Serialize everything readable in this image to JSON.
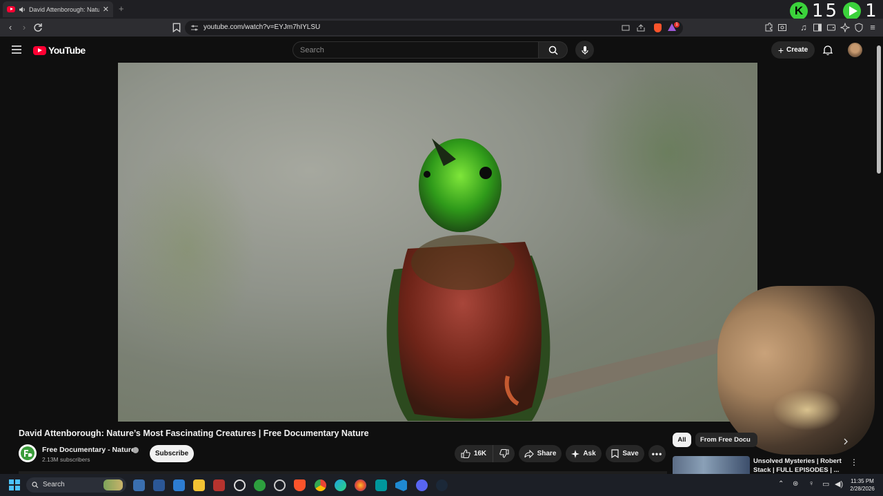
{
  "browser": {
    "tab_title": "David Attenborough: Nature's",
    "new_tab_symbol": "+",
    "url": "youtube.com/watch?v=EYJm7hIYLSU",
    "badge_count": "1"
  },
  "overlay": {
    "counter_a": "15",
    "counter_b": "1",
    "k_letter": "K"
  },
  "masthead": {
    "logo_text": "YouTube",
    "search_placeholder": "Search",
    "create_label": "Create"
  },
  "video": {
    "title": "David Attenborough: Nature’s Most Fascinating Creatures | Free Documentary Nature"
  },
  "channel": {
    "name": "Free Documentary - Nature",
    "subscribers": "2.13M subscribers",
    "subscribe_label": "Subscribe"
  },
  "actions": {
    "like_count": "16K",
    "share_label": "Share",
    "ask_label": "Ask",
    "save_label": "Save"
  },
  "sidebar": {
    "chips": [
      "All",
      "From Free Docu"
    ],
    "recommendation_title": "Unsolved Mysteries | Robert Stack | FULL EPISODES | ..."
  },
  "taskbar": {
    "search_label": "Search",
    "time": "11:35 PM",
    "date": "2/28/2026"
  },
  "colors": {
    "youtube_red": "#ff0033",
    "page_bg": "#0f0f0f",
    "overlay_green": "#3bd23b"
  }
}
